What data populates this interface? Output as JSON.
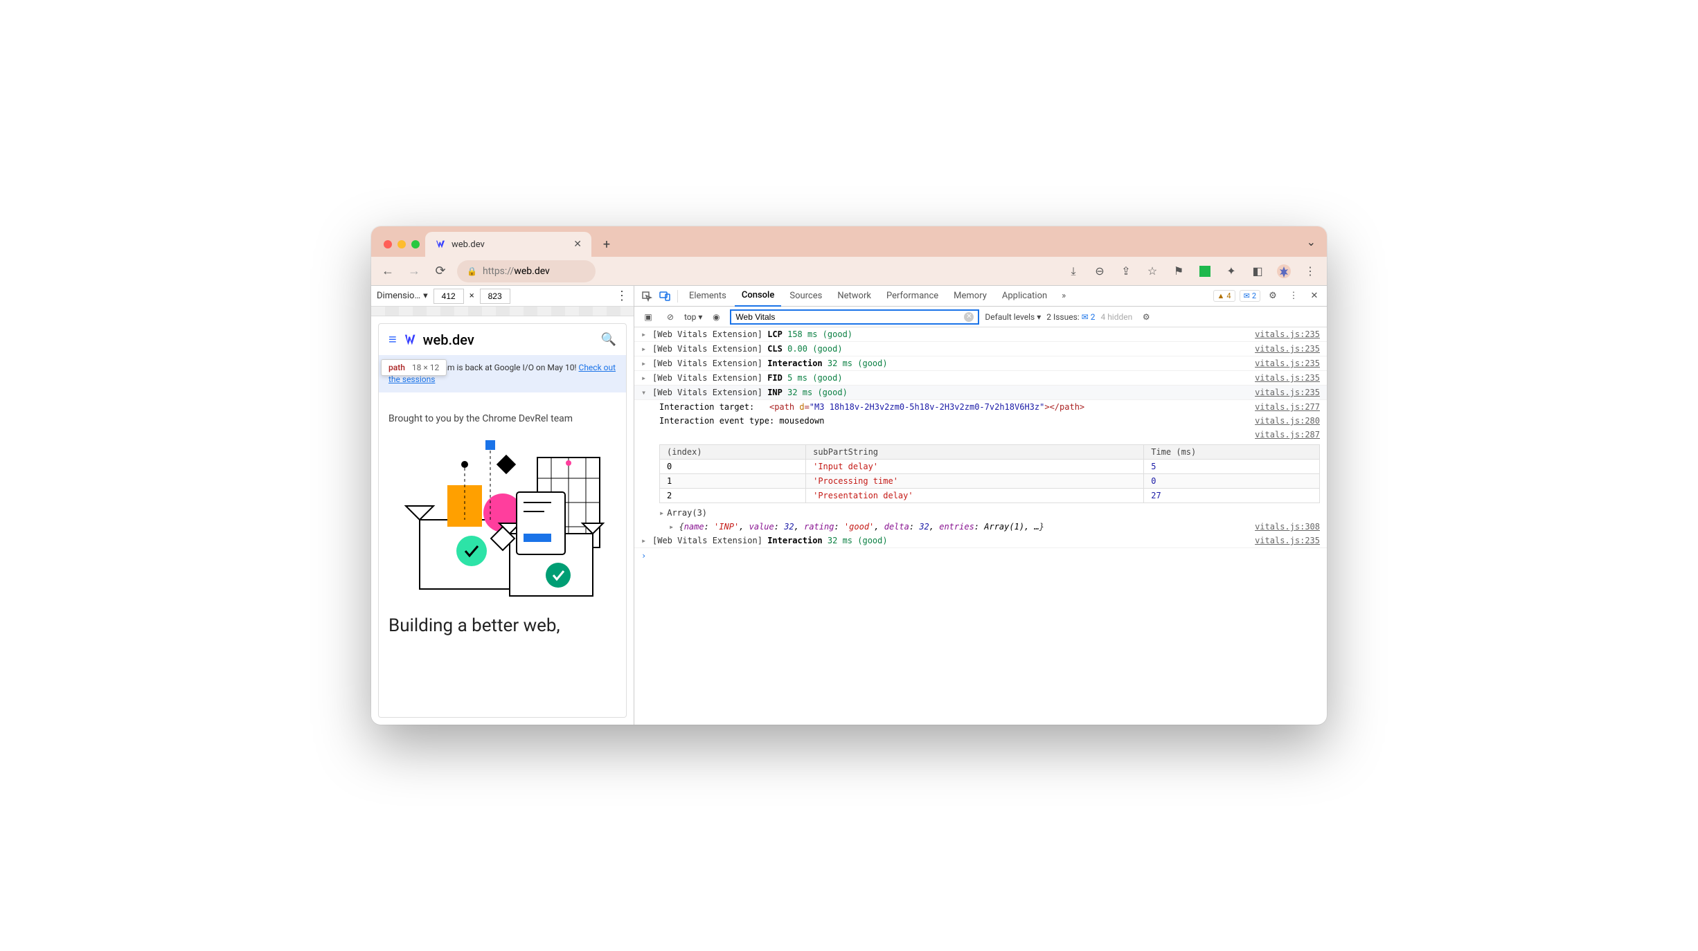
{
  "browser": {
    "tab_title": "web.dev",
    "url_display": "https://web.dev",
    "url_scheme": "https://",
    "url_host": "web.dev"
  },
  "device_bar": {
    "label": "Dimensio…",
    "width": "412",
    "sep": "×",
    "height": "823"
  },
  "tooltip": {
    "tag": "path",
    "size": "18 × 12"
  },
  "site": {
    "brand": "web.dev",
    "banner_text": "The Chrome team is back at Google I/O on May 10! ",
    "banner_link": "Check out the sessions",
    "hero_sub": "Brought to you by the Chrome DevRel team",
    "hero_title": "Building a better web,"
  },
  "devtools": {
    "panels": [
      "Elements",
      "Console",
      "Sources",
      "Network",
      "Performance",
      "Memory",
      "Application"
    ],
    "active_panel": "Console",
    "warn_count": "4",
    "info_count": "2",
    "context": "top",
    "filter": "Web Vitals",
    "levels": "Default levels",
    "issues_label": "2 Issues:",
    "issues_count": "2",
    "hidden": "4 hidden"
  },
  "console": {
    "lines": [
      {
        "prefix": "[Web Vitals Extension]",
        "metric": "LCP",
        "value": "158 ms (good)",
        "src": "vitals.js:235",
        "expanded": false
      },
      {
        "prefix": "[Web Vitals Extension]",
        "metric": "CLS",
        "value": "0.00 (good)",
        "src": "vitals.js:235",
        "expanded": false
      },
      {
        "prefix": "[Web Vitals Extension]",
        "metric": "Interaction",
        "value": "32 ms (good)",
        "src": "vitals.js:235",
        "expanded": false
      },
      {
        "prefix": "[Web Vitals Extension]",
        "metric": "FID",
        "value": "5 ms (good)",
        "src": "vitals.js:235",
        "expanded": false
      },
      {
        "prefix": "[Web Vitals Extension]",
        "metric": "INP",
        "value": "32 ms (good)",
        "src": "vitals.js:235",
        "expanded": true
      }
    ],
    "target_label": "Interaction target:",
    "target_html_open": "<path ",
    "target_attr": "d",
    "target_eq": "=",
    "target_val": "\"M3 18h18v-2H3v2zm0-5h18v-2H3v2zm0-7v2h18V6H3z\"",
    "target_html_close": "></path>",
    "target_src": "vitals.js:277",
    "event_label": "Interaction event type: ",
    "event_value": "mousedown",
    "event_src": "vitals.js:280",
    "table_src": "vitals.js:287",
    "table": {
      "headers": [
        "(index)",
        "subPartString",
        "Time (ms)"
      ],
      "rows": [
        [
          "0",
          "'Input delay'",
          "5"
        ],
        [
          "1",
          "'Processing time'",
          "0"
        ],
        [
          "2",
          "'Presentation delay'",
          "27"
        ]
      ]
    },
    "array_label": "Array(3)",
    "obj_line": "{name: 'INP', value: 32, rating: 'good', delta: 32, entries: Array(1), …}",
    "obj_src": "vitals.js:308",
    "last": {
      "prefix": "[Web Vitals Extension]",
      "metric": "Interaction",
      "value": "32 ms (good)",
      "src": "vitals.js:235"
    }
  }
}
